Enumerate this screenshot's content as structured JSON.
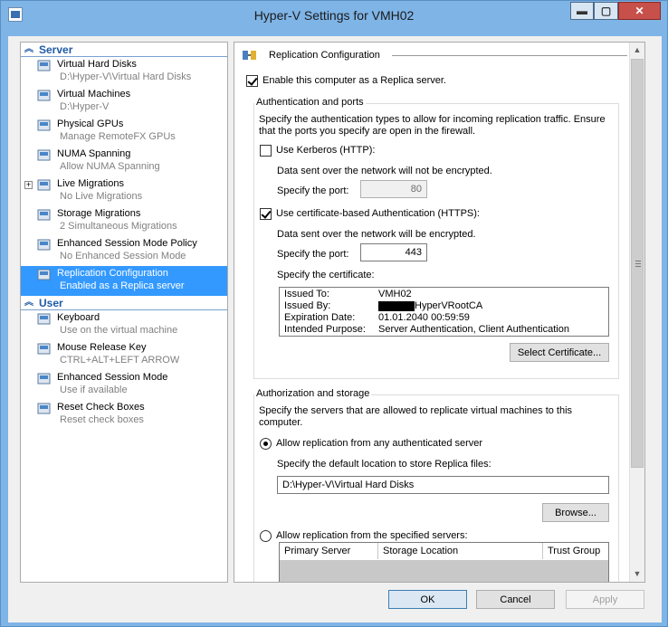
{
  "window": {
    "title": "Hyper-V Settings for VMH02",
    "min": "▬",
    "max": "▢",
    "close": "✕"
  },
  "tree": {
    "server_label": "Server",
    "user_label": "User",
    "server_items": [
      {
        "label": "Virtual Hard Disks",
        "sub": "D:\\Hyper-V\\Virtual Hard Disks",
        "icon": "disk-icon"
      },
      {
        "label": "Virtual Machines",
        "sub": "D:\\Hyper-V",
        "icon": "vm-folder-icon"
      },
      {
        "label": "Physical GPUs",
        "sub": "Manage RemoteFX GPUs",
        "icon": "gpu-icon"
      },
      {
        "label": "NUMA Spanning",
        "sub": "Allow NUMA Spanning",
        "icon": "numa-icon"
      },
      {
        "label": "Live Migrations",
        "sub": "No Live Migrations",
        "icon": "live-migration-icon",
        "expander": "+"
      },
      {
        "label": "Storage Migrations",
        "sub": "2 Simultaneous Migrations",
        "icon": "storage-migration-icon"
      },
      {
        "label": "Enhanced Session Mode Policy",
        "sub": "No Enhanced Session Mode",
        "icon": "session-policy-icon"
      },
      {
        "label": "Replication Configuration",
        "sub": "Enabled as a Replica server",
        "icon": "replication-icon",
        "selected": true
      }
    ],
    "user_items": [
      {
        "label": "Keyboard",
        "sub": "Use on the virtual machine",
        "icon": "keyboard-icon"
      },
      {
        "label": "Mouse Release Key",
        "sub": "CTRL+ALT+LEFT ARROW",
        "icon": "mouse-release-icon"
      },
      {
        "label": "Enhanced Session Mode",
        "sub": "Use if available",
        "icon": "session-icon"
      },
      {
        "label": "Reset Check Boxes",
        "sub": "Reset check boxes",
        "icon": "reset-checkbox-icon"
      }
    ]
  },
  "pane": {
    "header": "Replication Configuration",
    "enable_replica": "Enable this computer as a Replica server.",
    "auth_group": "Authentication and ports",
    "auth_desc": "Specify the authentication types to allow for incoming replication traffic. Ensure that the ports you specify are open in the firewall.",
    "kerberos_label": "Use Kerberos (HTTP):",
    "kerberos_note": "Data sent over the network will not be encrypted.",
    "port_label": "Specify the port:",
    "kerberos_port": "80",
    "cert_auth_label": "Use certificate-based Authentication (HTTPS):",
    "cert_note": "Data sent over the network will be encrypted.",
    "cert_port": "443",
    "cert_specify": "Specify the certificate:",
    "cert": {
      "issued_to_k": "Issued To:",
      "issued_to_v": "VMH02",
      "issued_by_k": "Issued By:",
      "issued_by_v": "HyperVRootCA",
      "exp_k": "Expiration Date:",
      "exp_v": "01.01.2040 00:59:59",
      "purpose_k": "Intended Purpose:",
      "purpose_v": "Server Authentication, Client Authentication"
    },
    "select_cert": "Select Certificate...",
    "authz_group": "Authorization and storage",
    "authz_desc": "Specify the servers that are allowed to replicate virtual machines to this computer.",
    "allow_any": "Allow replication from any authenticated server",
    "default_loc_label": "Specify the default location to store Replica files:",
    "default_loc": "D:\\Hyper-V\\Virtual Hard Disks",
    "browse": "Browse...",
    "allow_specified": "Allow replication from the specified servers:",
    "table_cols": [
      "Primary Server",
      "Storage Location",
      "Trust Group"
    ]
  },
  "footer": {
    "ok": "OK",
    "cancel": "Cancel",
    "apply": "Apply"
  },
  "colors": {
    "selection": "#3399ff",
    "section": "#1f5aa6",
    "titlebar": "#7fb4e6"
  }
}
